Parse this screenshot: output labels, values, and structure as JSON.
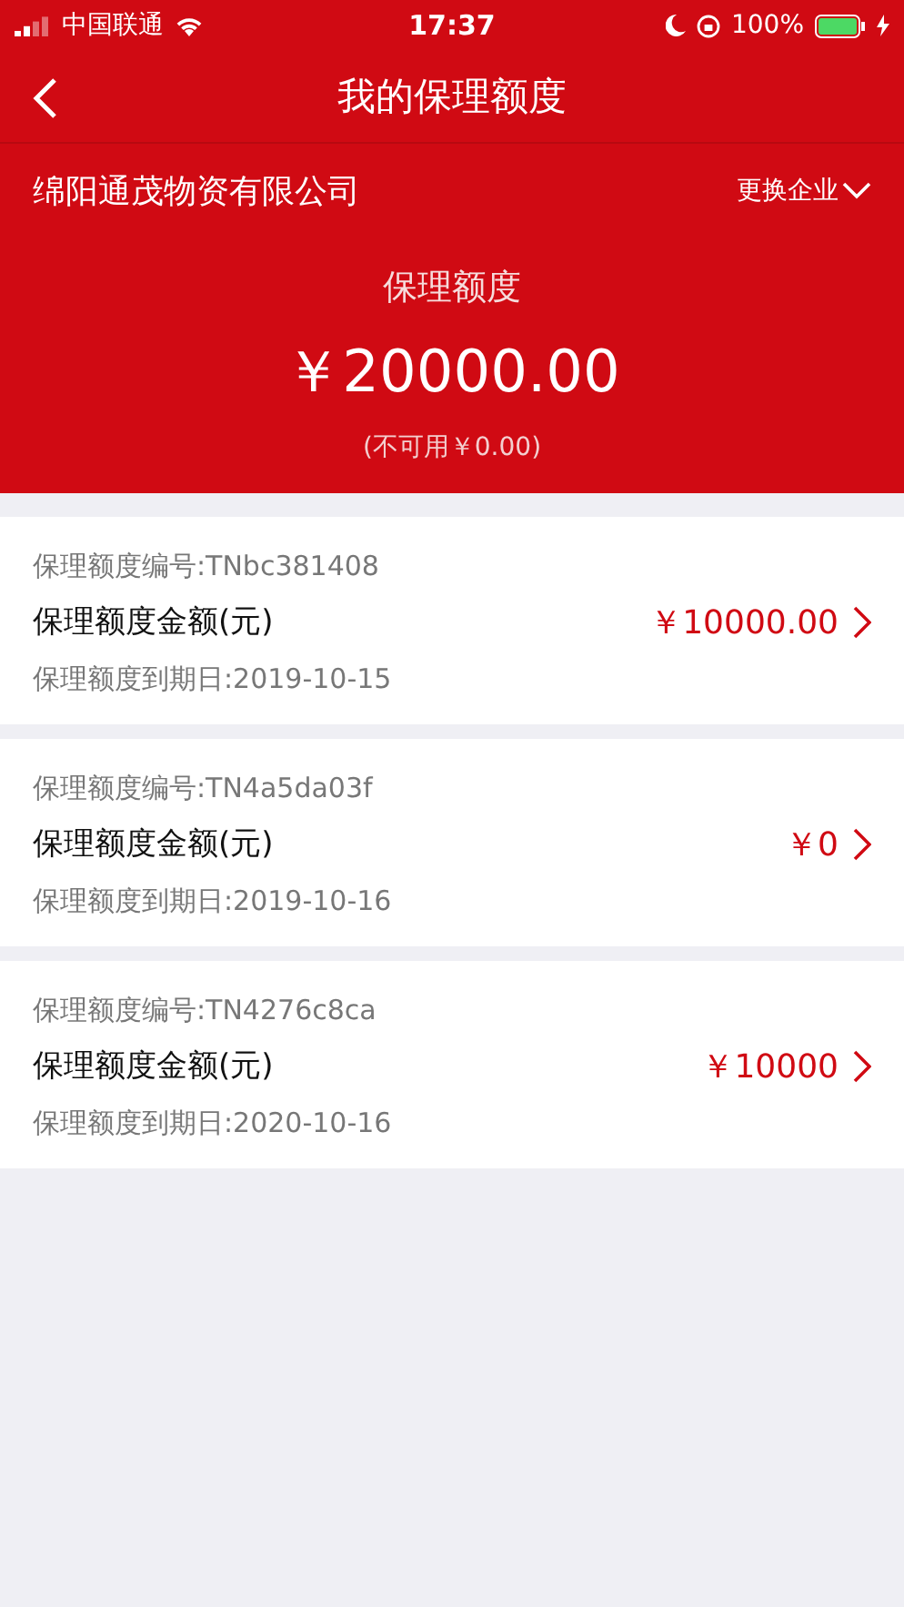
{
  "status_bar": {
    "carrier": "中国联通",
    "time": "17:37",
    "battery": "100%"
  },
  "nav": {
    "title": "我的保理额度"
  },
  "company": {
    "name": "绵阳通茂物资有限公司",
    "switch_label": "更换企业"
  },
  "summary": {
    "label": "保理额度",
    "amount": "￥20000.00",
    "unavailable": "(不可用￥0.00)"
  },
  "credits": [
    {
      "number": "保理额度编号:TNbc381408",
      "amount_label": "保理额度金额(元)",
      "amount": "￥10000.00",
      "due": "保理额度到期日:2019-10-15"
    },
    {
      "number": "保理额度编号:TN4a5da03f",
      "amount_label": "保理额度金额(元)",
      "amount": "￥0",
      "due": "保理额度到期日:2019-10-16"
    },
    {
      "number": "保理额度编号:TN4276c8ca",
      "amount_label": "保理额度金额(元)",
      "amount": "￥10000",
      "due": "保理额度到期日:2020-10-16"
    }
  ]
}
